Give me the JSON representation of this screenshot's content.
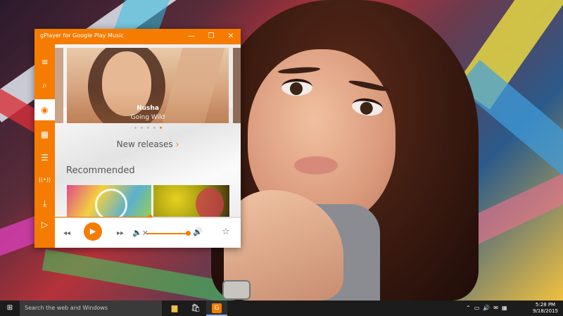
{
  "window": {
    "title": "gPlayer for Google Play Music",
    "controls": {
      "minimize": "—",
      "maximize": "❐",
      "close": "✕"
    }
  },
  "rail": {
    "items": [
      {
        "icon": "≡",
        "name": "menu-icon"
      },
      {
        "icon": "⌕",
        "name": "search-icon"
      },
      {
        "icon": "◉",
        "name": "listen-now-icon"
      },
      {
        "icon": "▦",
        "name": "library-icon"
      },
      {
        "icon": "☰",
        "name": "playlists-icon"
      },
      {
        "icon": "((•))",
        "name": "radio-icon"
      },
      {
        "icon": "⤓",
        "name": "downloads-icon"
      },
      {
        "icon": "▷",
        "name": "now-playing-icon"
      }
    ],
    "active_index": 2
  },
  "hero": {
    "artist": "Nusha",
    "album": "Going Wild",
    "pagination": {
      "count": 5,
      "active": 4
    }
  },
  "sections": {
    "new_releases": "New releases",
    "new_releases_chevron": "›",
    "recommended": "Recommended"
  },
  "player": {
    "prev": "◂◂",
    "play": "▶",
    "next": "▸▸",
    "mute": "🔈×",
    "volume_max": "🔊",
    "favorite": "☆",
    "progress": 0.51,
    "volume": 1.0
  },
  "taskbar": {
    "start_icon": "⊞",
    "search_placeholder": "Search the web and Windows",
    "apps": [
      {
        "name": "file-explorer",
        "icon": "▆"
      },
      {
        "name": "store",
        "icon": "🛍"
      },
      {
        "name": "gplayer",
        "icon": "G"
      }
    ],
    "tray_icons": [
      "⌃",
      "▭",
      "🔊",
      "✉",
      "▦"
    ],
    "time": "5:28 PM",
    "date": "9/18/2015"
  },
  "colors": {
    "accent": "#f57c00",
    "taskbar": "#1c1c1c"
  }
}
